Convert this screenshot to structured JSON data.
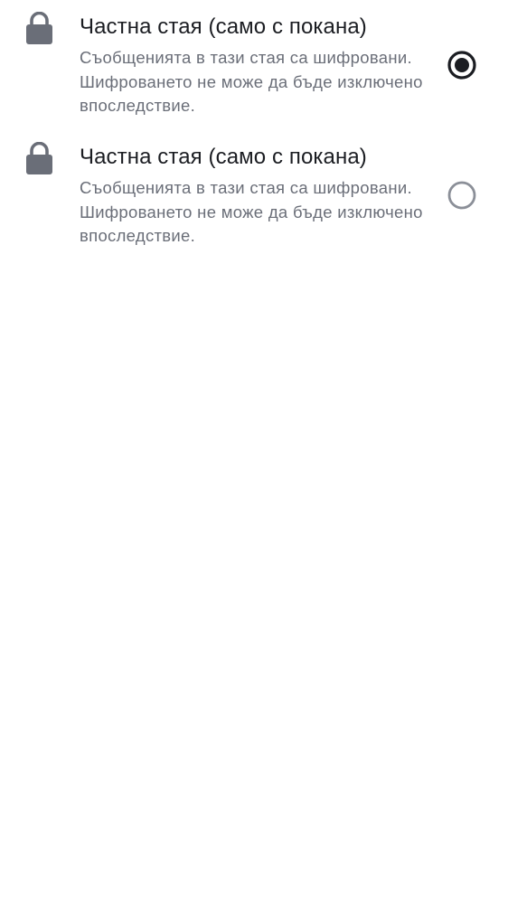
{
  "colors": {
    "title_text": "#1b1d22",
    "description_text": "#6a6e78",
    "lock_icon": "#6a6e78",
    "radio_selected": "#1b1d22",
    "radio_unselected": "#8b8f98",
    "background": "#ffffff"
  },
  "options": [
    {
      "icon": "lock-icon",
      "title": "Частна стая (само с покана)",
      "description": "Съобщенията в тази стая са шифровани. Шифроването не може да бъде изключено впоследствие.",
      "selected": true
    },
    {
      "icon": "lock-icon",
      "title": "Частна стая (само с покана)",
      "description": "Съобщенията в тази стая са шифровани. Шифроването не може да бъде изключено впоследствие.",
      "selected": false
    }
  ]
}
